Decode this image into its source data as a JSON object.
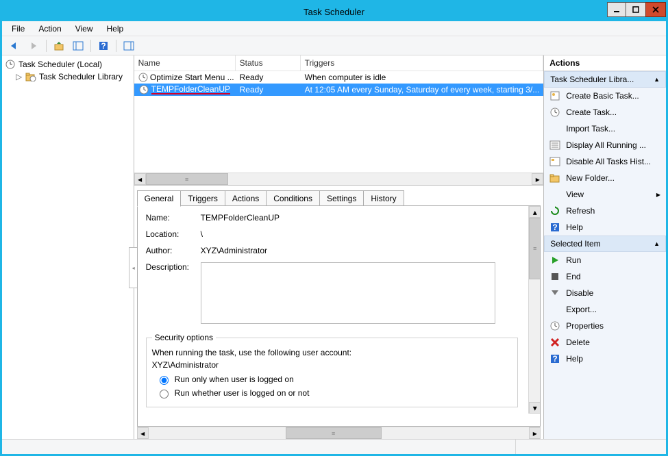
{
  "window": {
    "title": "Task Scheduler"
  },
  "menu": {
    "file": "File",
    "action": "Action",
    "view": "View",
    "help": "Help"
  },
  "tree": {
    "root": "Task Scheduler (Local)",
    "library": "Task Scheduler Library"
  },
  "list": {
    "headers": {
      "name": "Name",
      "status": "Status",
      "triggers": "Triggers"
    },
    "rows": [
      {
        "name": "Optimize Start Menu ...",
        "status": "Ready",
        "trigger": "When computer is idle"
      },
      {
        "name": "TEMPFolderCleanUP",
        "status": "Ready",
        "trigger": "At 12:05 AM every Sunday, Saturday of every week, starting 3/..."
      }
    ]
  },
  "tabs": {
    "general": "General",
    "triggers": "Triggers",
    "actions": "Actions",
    "conditions": "Conditions",
    "settings": "Settings",
    "history": "History"
  },
  "detail": {
    "labels": {
      "name": "Name:",
      "location": "Location:",
      "author": "Author:",
      "description": "Description:"
    },
    "name": "TEMPFolderCleanUP",
    "location": "\\",
    "author": "XYZ\\Administrator",
    "description": "",
    "security": {
      "title": "Security options",
      "run_account_label": "When running the task, use the following user account:",
      "account": "XYZ\\Administrator",
      "radio1": "Run only when user is logged on",
      "radio2": "Run whether user is logged on or not"
    }
  },
  "actions": {
    "header": "Actions",
    "section1": "Task Scheduler Libra...",
    "items1": [
      "Create Basic Task...",
      "Create Task...",
      "Import Task...",
      "Display All Running ...",
      "Disable All Tasks Hist...",
      "New Folder...",
      "View",
      "Refresh",
      "Help"
    ],
    "section2": "Selected Item",
    "items2": [
      "Run",
      "End",
      "Disable",
      "Export...",
      "Properties",
      "Delete",
      "Help"
    ]
  }
}
